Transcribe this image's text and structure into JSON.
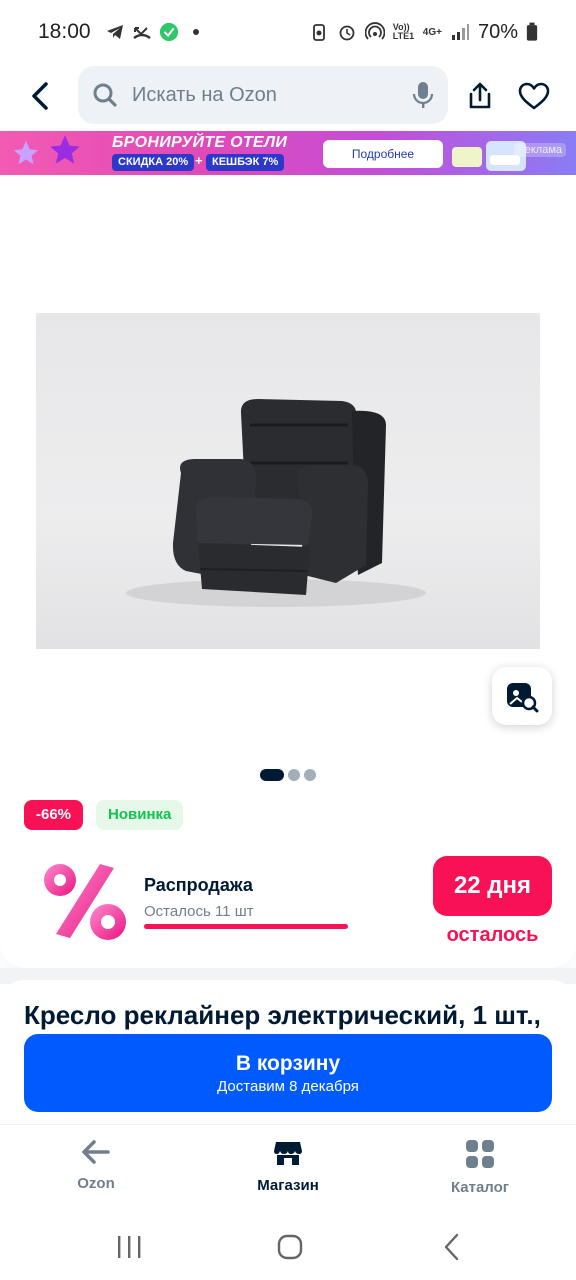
{
  "status_bar": {
    "time": "18:00",
    "battery": "70%",
    "network_label_1": "Vo)) LTE1",
    "network_label_2": "4G+"
  },
  "header": {
    "search_placeholder": "Искать на Ozon"
  },
  "banner": {
    "title": "БРОНИРУЙТЕ ОТЕЛИ",
    "chip_1": "СКИДКА 20%",
    "plus": "+",
    "chip_2": "КЕШБЭК 7%",
    "button": "Подробнее",
    "ad_label": "Реклама"
  },
  "gallery": {
    "image_alt": "Кресло реклайнер",
    "pages": 3,
    "active_page": 1
  },
  "badges": {
    "discount": "-66%",
    "new": "Новинка"
  },
  "sale": {
    "title": "Распродажа",
    "remaining": "Осталось 11 шт",
    "days": "22 дня",
    "days_label": "осталось",
    "accent_color": "#f91155"
  },
  "product": {
    "title": "Кресло реклайнер электрический, 1 шт.,"
  },
  "cart": {
    "label": "В корзину",
    "delivery": "Доставим 8 декабря",
    "color": "#005bff"
  },
  "bottom_nav": {
    "items": [
      {
        "label": "Ozon",
        "icon": "arrow-left-icon",
        "active": false
      },
      {
        "label": "Магазин",
        "icon": "store-icon",
        "active": true
      },
      {
        "label": "Каталог",
        "icon": "grid-icon",
        "active": false
      }
    ]
  }
}
